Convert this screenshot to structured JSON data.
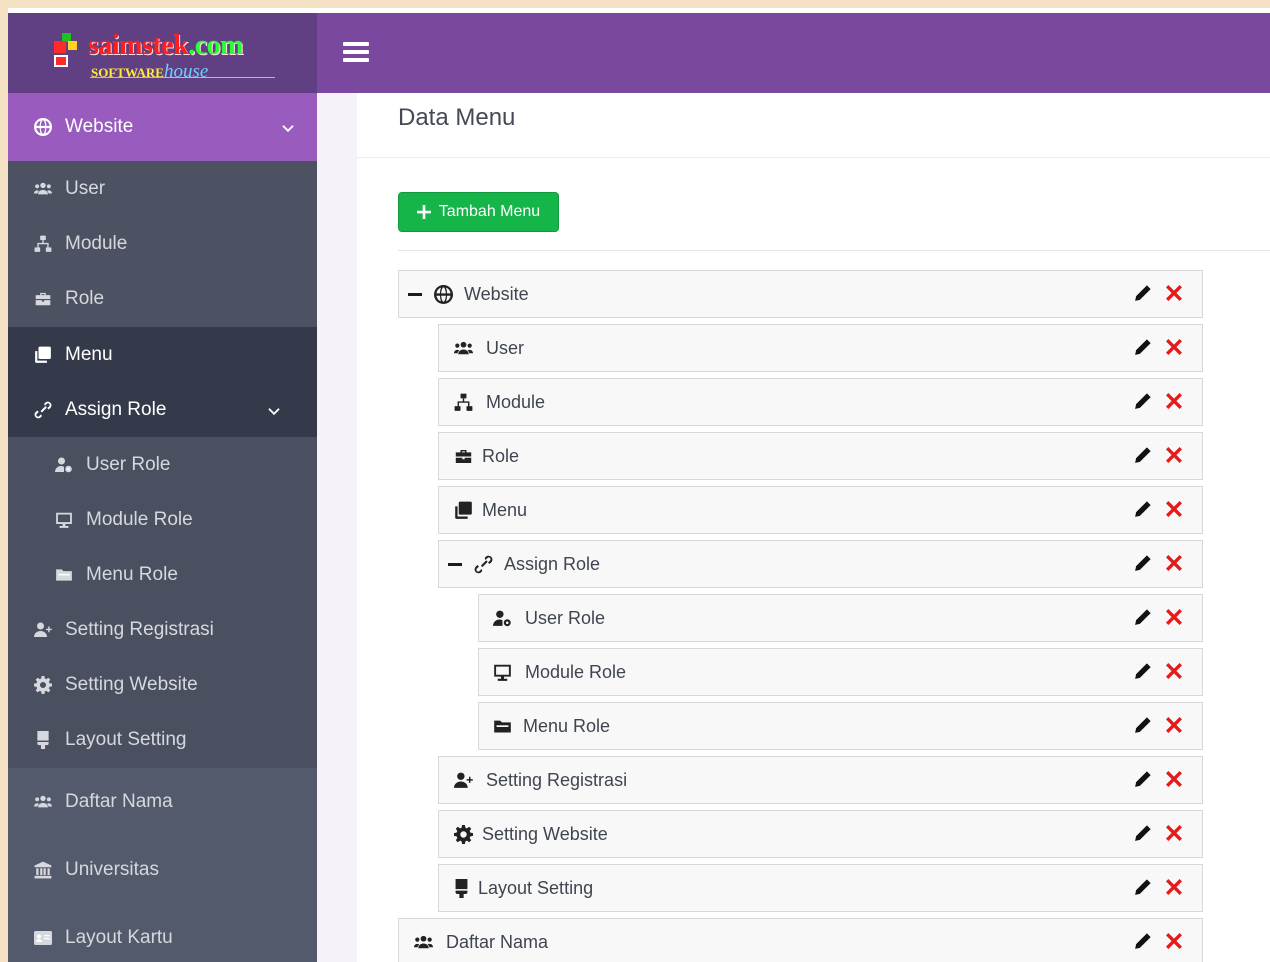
{
  "brand": {
    "name": "saimstek",
    "dot_com": ".com",
    "tagline_bold": "SOFTWARE",
    "tagline_italic": "house"
  },
  "sidebar": {
    "header": {
      "label": "Website",
      "icon": "globe-icon"
    },
    "items": [
      {
        "label": "User",
        "icon": "users-icon"
      },
      {
        "label": "Module",
        "icon": "sitemap-icon"
      },
      {
        "label": "Role",
        "icon": "briefcase-icon"
      },
      {
        "label": "Menu",
        "icon": "clone-icon"
      },
      {
        "label": "Assign Role",
        "icon": "link-icon"
      },
      {
        "label": "User Role",
        "icon": "user-cog-icon"
      },
      {
        "label": "Module Role",
        "icon": "desktop-icon"
      },
      {
        "label": "Menu Role",
        "icon": "folder-icon"
      },
      {
        "label": "Setting Registrasi",
        "icon": "user-plus-icon"
      },
      {
        "label": "Setting Website",
        "icon": "cog-icon"
      },
      {
        "label": "Layout Setting",
        "icon": "brush-icon"
      },
      {
        "label": "Daftar Nama",
        "icon": "users-icon"
      },
      {
        "label": "Universitas",
        "icon": "university-icon"
      },
      {
        "label": "Layout Kartu",
        "icon": "id-card-icon"
      }
    ]
  },
  "main": {
    "title": "Data Menu",
    "add_button_label": "Tambah Menu",
    "tree": [
      {
        "label": "Website",
        "icon": "globe-icon"
      },
      {
        "label": "User",
        "icon": "users-icon"
      },
      {
        "label": "Module",
        "icon": "sitemap-icon"
      },
      {
        "label": "Role",
        "icon": "briefcase-icon"
      },
      {
        "label": "Menu",
        "icon": "clone-icon"
      },
      {
        "label": "Assign Role",
        "icon": "link-icon"
      },
      {
        "label": "User Role",
        "icon": "user-cog-icon"
      },
      {
        "label": "Module Role",
        "icon": "desktop-icon"
      },
      {
        "label": "Menu Role",
        "icon": "folder-icon"
      },
      {
        "label": "Setting Registrasi",
        "icon": "user-plus-icon"
      },
      {
        "label": "Setting Website",
        "icon": "cog-icon"
      },
      {
        "label": "Layout Setting",
        "icon": "brush-icon"
      },
      {
        "label": "Daftar Nama",
        "icon": "users-icon"
      }
    ]
  },
  "colors": {
    "topbar": "#7a489f",
    "brand_bg": "#603f82",
    "sidebar_bg": "#4d5263",
    "sidebar_active": "#9a5bbf",
    "sidebar_current": "#343a4a",
    "add_button": "#16b54a",
    "delete": "#e51b1b"
  }
}
